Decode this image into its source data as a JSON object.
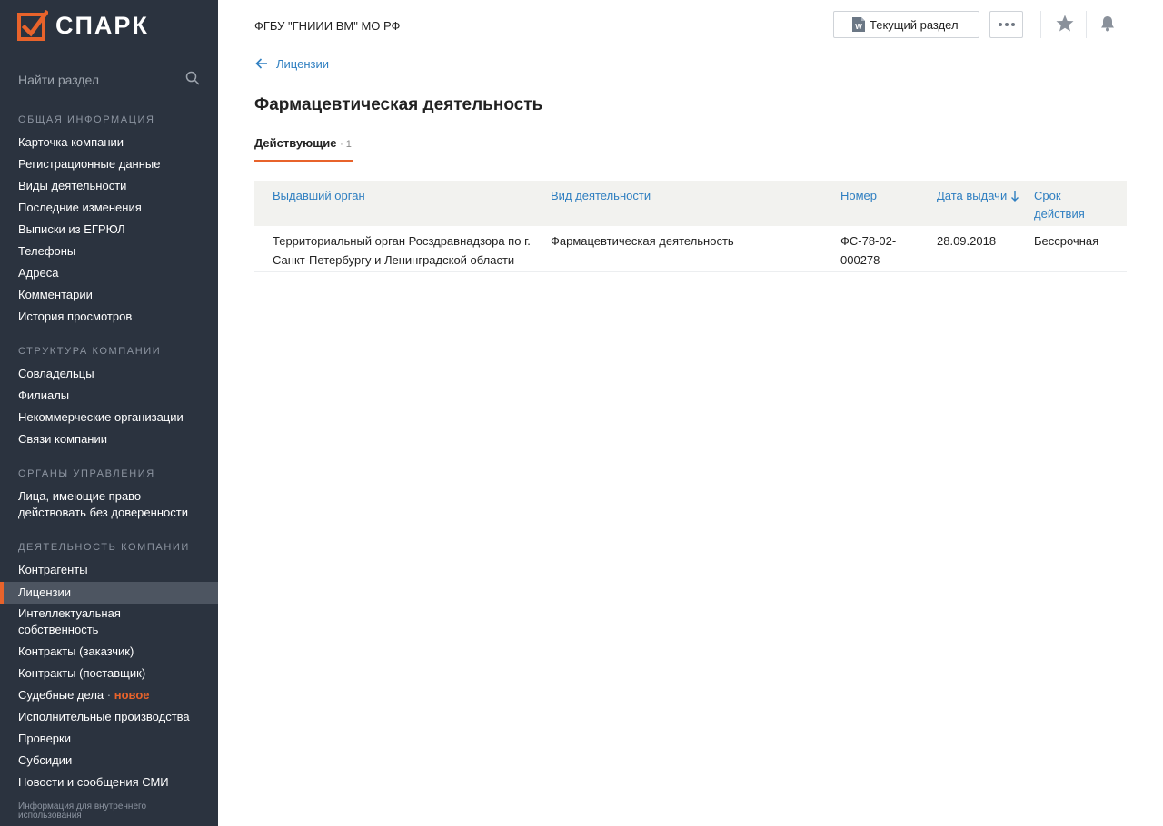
{
  "sidebar": {
    "logo_text": "СПАРК",
    "search_placeholder": "Найти раздел",
    "sections": [
      {
        "title": "ОБЩАЯ ИНФОРМАЦИЯ"
      },
      {
        "title": "СТРУКТУРА КОМПАНИИ"
      },
      {
        "title": "ОРГАНЫ УПРАВЛЕНИЯ"
      },
      {
        "title": "ДЕЯТЕЛЬНОСТЬ КОМПАНИИ"
      }
    ],
    "items": {
      "card": "Карточка компании",
      "reg": "Регистрационные данные",
      "activity_types": "Виды деятельности",
      "changes": "Последние изменения",
      "egrul": "Выписки из ЕГРЮЛ",
      "phones": "Телефоны",
      "addresses": "Адреса",
      "comments": "Комментарии",
      "history": "История просмотров",
      "owners": "Совладельцы",
      "branches": "Филиалы",
      "nonprofit": "Некоммерческие организации",
      "links": "Связи компании",
      "persons_1": "Лица, имеющие право",
      "persons_2": "действовать без доверенности",
      "contractors": "Контрагенты",
      "licenses": "Лицензии",
      "ip_1": "Интеллектуальная",
      "ip_2": "собственность",
      "contracts_customer": "Контракты (заказчик)",
      "contracts_supplier": "Контракты (поставщик)",
      "court": "Судебные дела",
      "court_badge": "новое",
      "enforcement": "Исполнительные производства",
      "inspections": "Проверки",
      "subsidies": "Субсидии",
      "news": "Новости и сообщения СМИ"
    },
    "footnote": "Информация для внутреннего использования"
  },
  "header": {
    "company": "ФГБУ \"ГНИИИ ВМ\" МО РФ",
    "current_section_label": "Текущий раздел"
  },
  "main": {
    "back_label": "Лицензии",
    "title": "Фармацевтическая деятельность",
    "tab_label": "Действующие",
    "tab_count": "1",
    "columns": {
      "issuer": "Выдавший орган",
      "activity": "Вид деятельности",
      "number": "Номер",
      "date": "Дата выдачи",
      "term_1": "Срок",
      "term_2": "действия"
    },
    "rows": [
      {
        "issuer_1": "Территориальный орган Росздравнадзора по г.",
        "issuer_2": "Санкт-Петербургу и Ленинградской области",
        "activity": "Фармацевтическая деятельность",
        "number_1": "ФС-78-02-",
        "number_2": "000278",
        "date": "28.09.2018",
        "term": "Бессрочная"
      }
    ]
  },
  "colors": {
    "sidebar_bg": "#2b333f",
    "accent": "#e8632b",
    "link": "#2f7fc1"
  }
}
